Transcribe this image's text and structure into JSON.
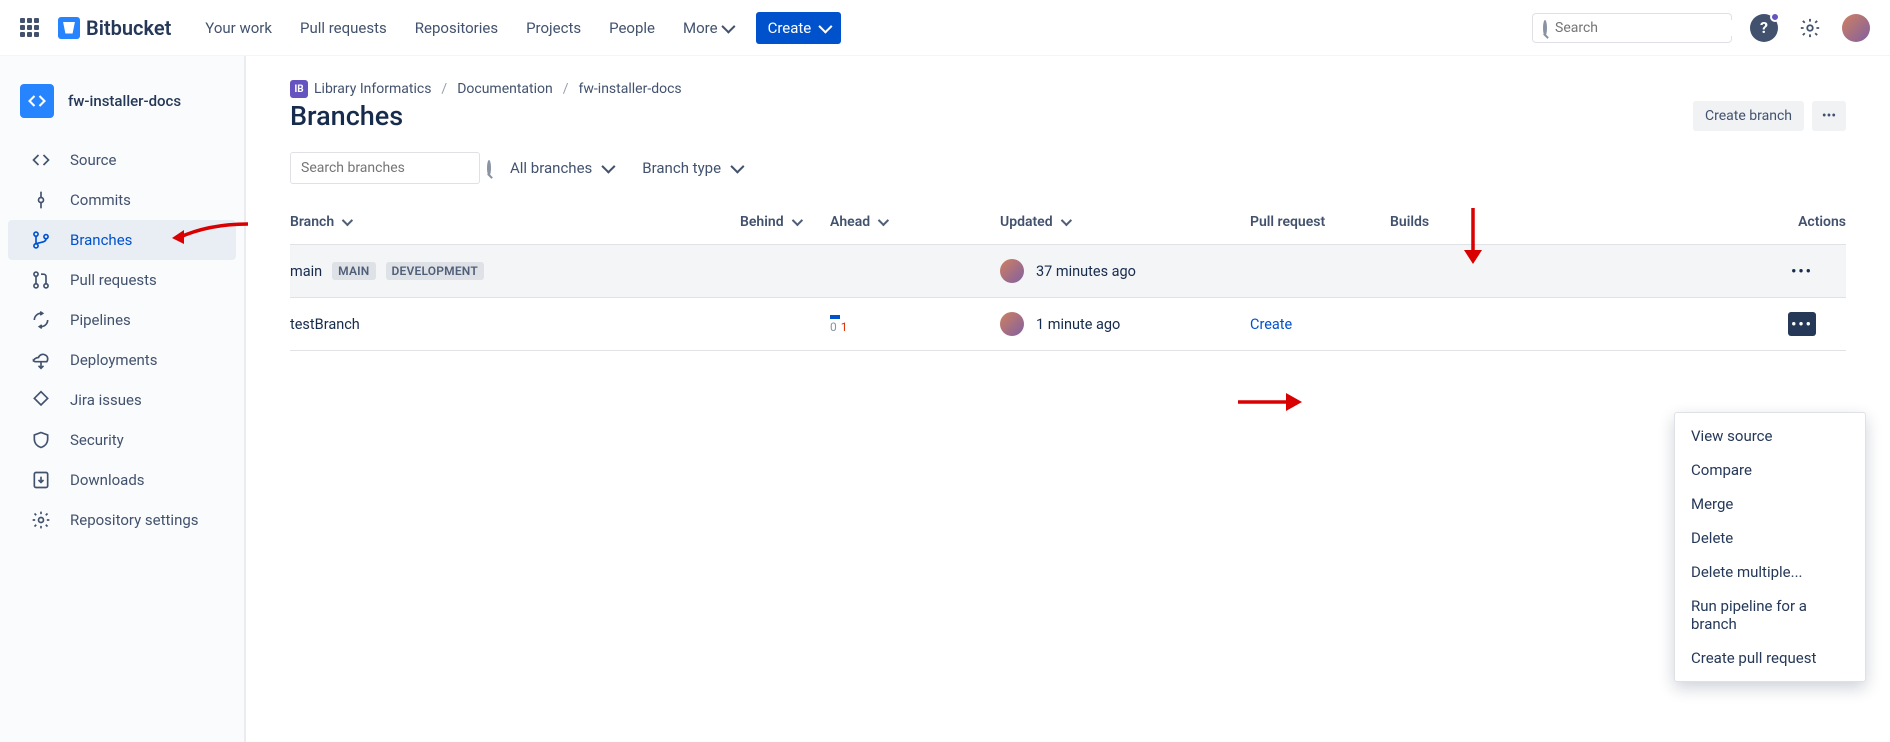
{
  "app": {
    "name": "Bitbucket"
  },
  "topnav": {
    "your_work": "Your work",
    "pull_requests": "Pull requests",
    "repositories": "Repositories",
    "projects": "Projects",
    "people": "People",
    "more": "More",
    "create": "Create",
    "search_placeholder": "Search"
  },
  "repo": {
    "name": "fw-installer-docs"
  },
  "sidebar": {
    "items": [
      {
        "label": "Source",
        "icon": "code"
      },
      {
        "label": "Commits",
        "icon": "commit"
      },
      {
        "label": "Branches",
        "icon": "branch"
      },
      {
        "label": "Pull requests",
        "icon": "pull"
      },
      {
        "label": "Pipelines",
        "icon": "pipe"
      },
      {
        "label": "Deployments",
        "icon": "deploy"
      },
      {
        "label": "Jira issues",
        "icon": "jira"
      },
      {
        "label": "Security",
        "icon": "shield"
      },
      {
        "label": "Downloads",
        "icon": "download"
      },
      {
        "label": "Repository settings",
        "icon": "gear"
      }
    ],
    "active_index": 2
  },
  "breadcrumbs": [
    {
      "label": "Library Informatics"
    },
    {
      "label": "Documentation"
    },
    {
      "label": "fw-installer-docs"
    }
  ],
  "page": {
    "title": "Branches",
    "create_branch": "Create branch",
    "search_placeholder": "Search branches",
    "filter_all": "All branches",
    "filter_type": "Branch type"
  },
  "columns": {
    "branch": "Branch",
    "behind": "Behind",
    "ahead": "Ahead",
    "updated": "Updated",
    "pull_request": "Pull request",
    "builds": "Builds",
    "actions": "Actions"
  },
  "rows": [
    {
      "name": "main",
      "tags": [
        "MAIN",
        "DEVELOPMENT"
      ],
      "behind": "",
      "ahead": "",
      "updated": "37 minutes ago",
      "pr": "",
      "is_main": true
    },
    {
      "name": "testBranch",
      "tags": [],
      "behind": "0",
      "ahead": "1",
      "updated": "1 minute ago",
      "pr": "Create",
      "is_main": false
    }
  ],
  "menu": {
    "view_source": "View source",
    "compare": "Compare",
    "merge": "Merge",
    "delete": "Delete",
    "delete_multiple": "Delete multiple...",
    "run_pipeline": "Run pipeline for a branch",
    "create_pr": "Create pull request"
  }
}
